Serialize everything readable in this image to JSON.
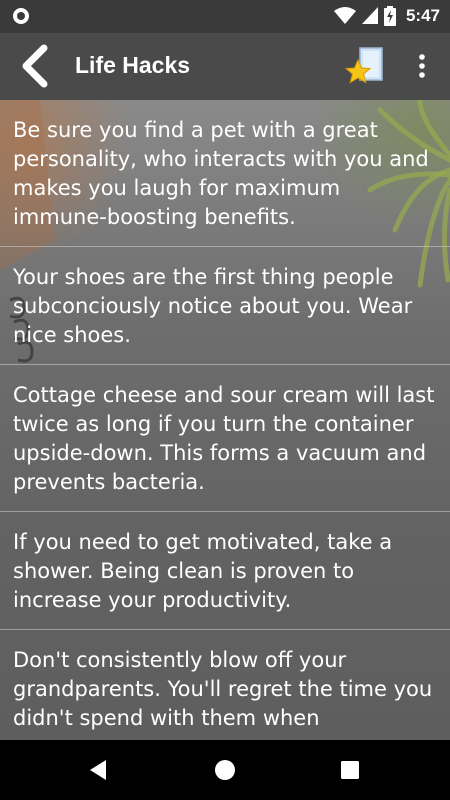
{
  "status_bar": {
    "time": "5:47",
    "icons": [
      "circle-notification-icon",
      "wifi-icon",
      "cellular-signal-icon",
      "battery-charging-icon"
    ]
  },
  "app_bar": {
    "title": "Life Hacks",
    "icons": [
      "back-arrow-icon",
      "star-favorite-icon",
      "more-vert-icon"
    ]
  },
  "hacks": [
    {
      "text": "Be sure you find a pet with a great personality, who interacts with you and makes you laugh for maximum immune-boosting benefits."
    },
    {
      "text": "Your shoes are the first thing people subconciously notice about you. Wear nice shoes."
    },
    {
      "text": "Cottage cheese and sour cream will last twice as long if you turn the container upside-down. This forms a vacuum and prevents bacteria."
    },
    {
      "text": "If you need to get motivated, take a shower. Being clean is proven to increase your productivity."
    },
    {
      "text": "Don't consistently blow off your grandparents. You'll regret the time you didn't spend with them when"
    }
  ],
  "nav_bar": {
    "icons": [
      "back-triangle-icon",
      "home-circle-icon",
      "recents-square-icon"
    ]
  },
  "colors": {
    "status_bar": "#3a3a3a",
    "app_bar": "#4a4a4a",
    "text": "#ffffff",
    "star": "#f5c518"
  }
}
